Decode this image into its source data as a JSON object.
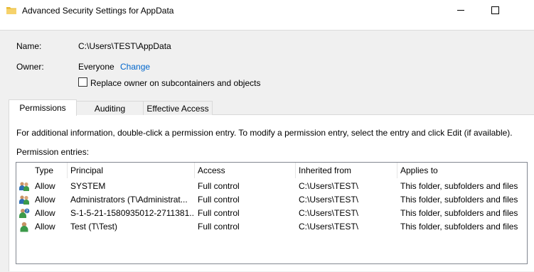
{
  "window": {
    "title": "Advanced Security Settings for AppData",
    "title_icon": "folder-icon"
  },
  "form": {
    "name_label": "Name:",
    "name_value": "C:\\Users\\TEST\\AppData",
    "owner_label": "Owner:",
    "owner_value": "Everyone",
    "change_link": "Change",
    "replace_owner_checkbox": {
      "label": "Replace owner on subcontainers and objects",
      "checked": false
    }
  },
  "tabs": [
    {
      "label": "Permissions",
      "active": true
    },
    {
      "label": "Auditing",
      "active": false
    },
    {
      "label": "Effective Access",
      "active": false
    }
  ],
  "permissions_tab": {
    "info_text": "For additional information, double-click a permission entry. To modify a permission entry, select the entry and click Edit (if available).",
    "entries_label": "Permission entries:",
    "columns": [
      "Type",
      "Principal",
      "Access",
      "Inherited from",
      "Applies to"
    ],
    "rows": [
      {
        "icon": "group-users-icon",
        "type": "Allow",
        "principal": "SYSTEM",
        "access": "Full control",
        "inherited_from": "C:\\Users\\TEST\\",
        "applies_to": "This folder, subfolders and files"
      },
      {
        "icon": "group-users-icon",
        "type": "Allow",
        "principal": "Administrators (T\\Administrat...",
        "access": "Full control",
        "inherited_from": "C:\\Users\\TEST\\",
        "applies_to": "This folder, subfolders and files"
      },
      {
        "icon": "unknown-user-icon",
        "type": "Allow",
        "principal": "S-1-5-21-1580935012-2711381...",
        "access": "Full control",
        "inherited_from": "C:\\Users\\TEST\\",
        "applies_to": "This folder, subfolders and files"
      },
      {
        "icon": "user-icon",
        "type": "Allow",
        "principal": "Test (T\\Test)",
        "access": "Full control",
        "inherited_from": "C:\\Users\\TEST\\",
        "applies_to": "This folder, subfolders and files"
      }
    ]
  },
  "colors": {
    "link": "#0066cc",
    "content_bg": "#f0f0f0",
    "panel_bg": "#ffffff"
  }
}
